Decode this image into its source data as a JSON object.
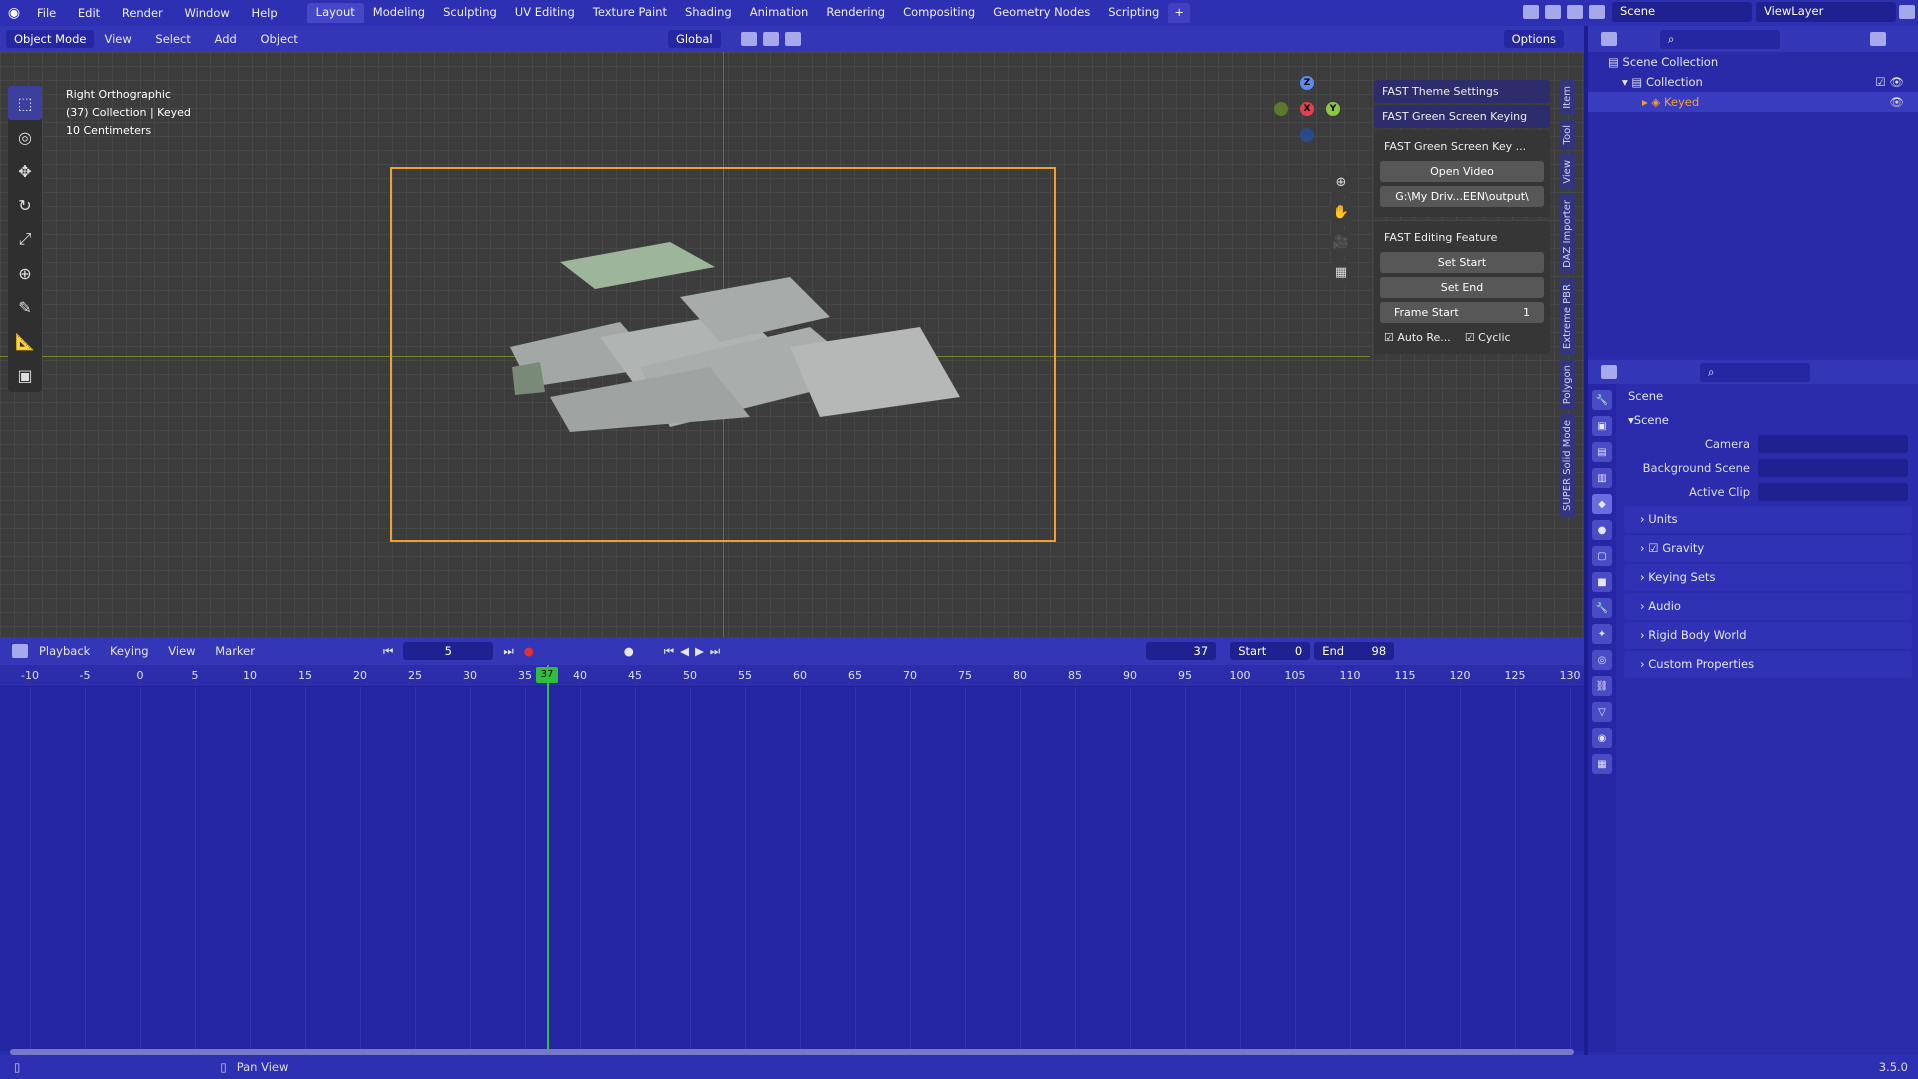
{
  "menu": [
    "File",
    "Edit",
    "Render",
    "Window",
    "Help"
  ],
  "workspaces": [
    "Layout",
    "Modeling",
    "Sculpting",
    "UV Editing",
    "Texture Paint",
    "Shading",
    "Animation",
    "Rendering",
    "Compositing",
    "Geometry Nodes",
    "Scripting"
  ],
  "active_workspace": "Layout",
  "scene_field": "Scene",
  "viewlayer_field": "ViewLayer",
  "viewport": {
    "mode": "Object Mode",
    "menus": [
      "View",
      "Select",
      "Add",
      "Object"
    ],
    "orientation": "Global",
    "options_label": "Options",
    "info_line1": "Right Orthographic",
    "info_line2": "(37) Collection | Keyed",
    "info_line3": "10 Centimeters"
  },
  "npanel": {
    "theme_header": "FAST Theme Settings",
    "keying_header": "FAST Green Screen Keying",
    "keying_title": "FAST Green Screen Key ...",
    "open_video": "Open Video",
    "path": "G:\\My Driv...EEN\\output\\",
    "editing_title": "FAST Editing Feature",
    "set_start": "Set Start",
    "set_end": "Set End",
    "frame_start_label": "Frame Start",
    "frame_start_value": "1",
    "auto_re": "Auto Re...",
    "cyclic": "Cyclic",
    "tabs": [
      "Item",
      "Tool",
      "View",
      "DAZ Importer",
      "Extreme PBR",
      "Polygon",
      "SUPER Solid Mode"
    ]
  },
  "timeline": {
    "menus": [
      "Playback",
      "Keying",
      "View",
      "Marker"
    ],
    "step": "5",
    "current_frame": "37",
    "start_label": "Start",
    "start_value": "0",
    "end_label": "End",
    "end_value": "98",
    "ticks": [
      "-10",
      "-5",
      "0",
      "5",
      "10",
      "15",
      "20",
      "25",
      "30",
      "35",
      "40",
      "45",
      "50",
      "55",
      "60",
      "65",
      "70",
      "75",
      "80",
      "85",
      "90",
      "95",
      "100",
      "105",
      "110",
      "115",
      "120",
      "125",
      "130"
    ]
  },
  "outliner": {
    "scene_collection": "Scene Collection",
    "collection": "Collection",
    "object": "Keyed"
  },
  "properties": {
    "scene_title": "Scene",
    "panel_scene": "Scene",
    "camera_label": "Camera",
    "background_label": "Background Scene",
    "clip_label": "Active Clip",
    "subpanels": [
      "Units",
      "Gravity",
      "Keying Sets",
      "Audio",
      "Rigid Body World",
      "Custom Properties"
    ]
  },
  "status": {
    "action": "Pan View",
    "version": "3.5.0"
  }
}
